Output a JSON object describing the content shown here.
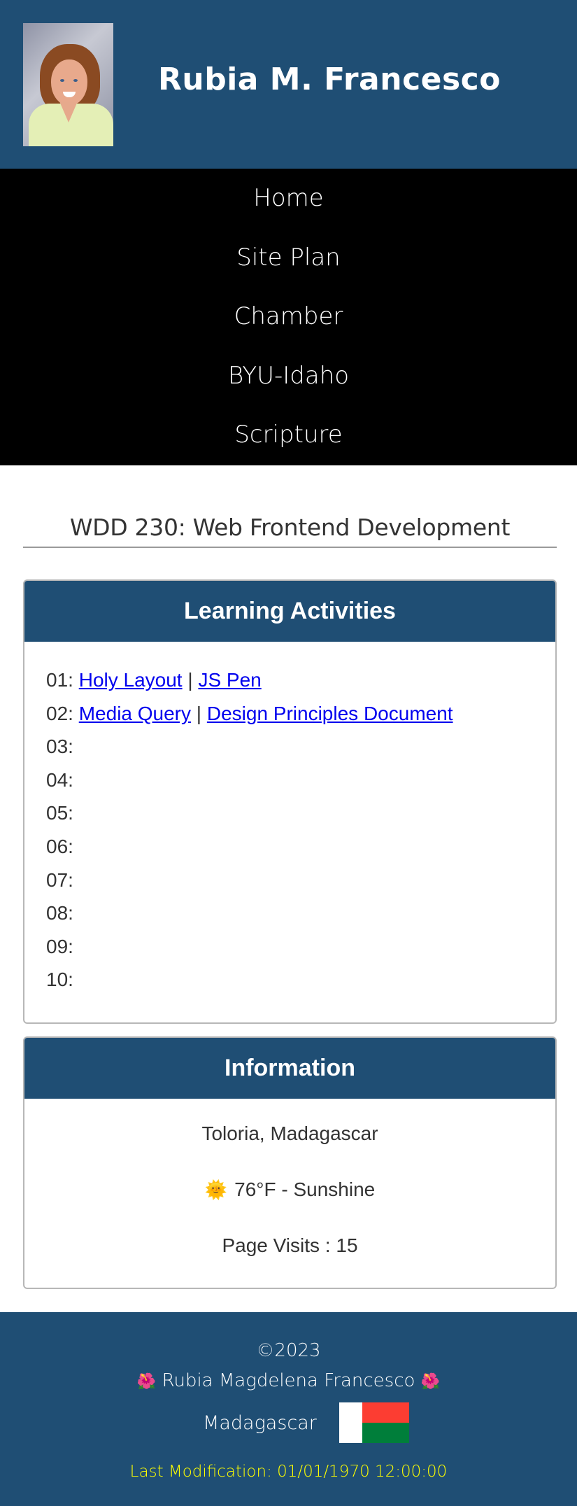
{
  "header": {
    "site_title": "Rubia M. Francesco",
    "portrait_alt": "photo of Rubia M. Francesco"
  },
  "nav": {
    "items": [
      {
        "label": "Home"
      },
      {
        "label": "Site Plan"
      },
      {
        "label": "Chamber"
      },
      {
        "label": "BYU-Idaho"
      },
      {
        "label": "Scripture"
      }
    ]
  },
  "main": {
    "page_title": "WDD 230: Web Frontend Development",
    "learning": {
      "heading": "Learning Activities",
      "separator": "|",
      "activities": [
        {
          "num": "01:",
          "links": [
            {
              "label": "Holy Layout"
            },
            {
              "label": "JS Pen"
            }
          ]
        },
        {
          "num": "02:",
          "links": [
            {
              "label": "Media Query"
            },
            {
              "label": "Design Principles Document"
            }
          ]
        },
        {
          "num": "03:"
        },
        {
          "num": "04:"
        },
        {
          "num": "05:"
        },
        {
          "num": "06:"
        },
        {
          "num": "07:"
        },
        {
          "num": "08:"
        },
        {
          "num": "09:"
        },
        {
          "num": "10:"
        }
      ]
    },
    "information": {
      "heading": "Information",
      "location": "Toloria, Madagascar",
      "weather_icon": "🌞",
      "weather": "76°F - Sunshine",
      "page_visits": "Page Visits : 15"
    }
  },
  "footer": {
    "copyright": "©2023",
    "flower_icon": "🌺",
    "author": "Rubia Magdelena Francesco",
    "country": "Madagascar",
    "flag_colors": {
      "white": "#ffffff",
      "red": "#fc3d32",
      "green": "#007e3a"
    },
    "last_modification": "Last Modification: 01/01/1970 12:00:00"
  },
  "colors": {
    "brand_blue": "#1f4e74",
    "nav_bg": "#000000",
    "link": "#0000ee",
    "last_mod_yellow": "#ffff00"
  }
}
